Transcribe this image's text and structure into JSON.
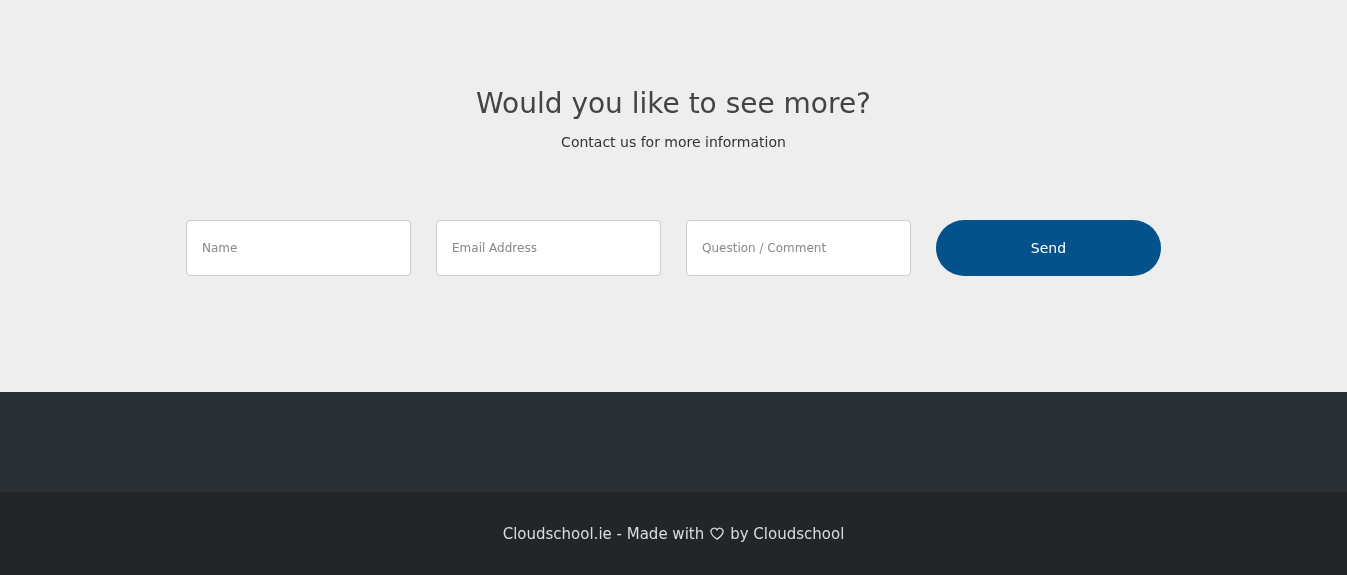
{
  "contact": {
    "title": "Would you like to see more?",
    "subtitle": "Contact us for more information",
    "fields": [
      {
        "placeholder": "Name"
      },
      {
        "placeholder": "Email Address"
      },
      {
        "placeholder": "Question / Comment"
      }
    ],
    "button": "Send"
  },
  "footer": {
    "text_before": "Cloudschool.ie - Made with",
    "text_after": "by Cloudschool"
  }
}
